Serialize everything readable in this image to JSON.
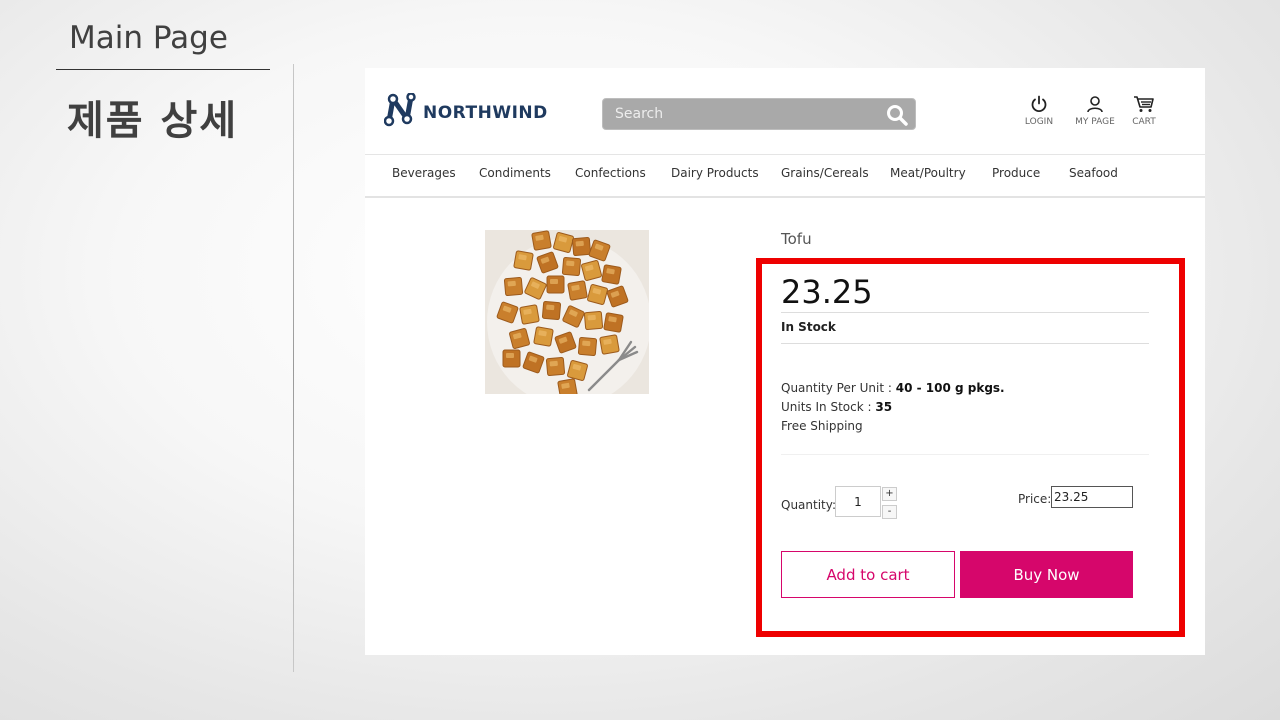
{
  "slide": {
    "title": "Main Page",
    "subtitle": "제품 상세"
  },
  "site": {
    "logo_text": "NORTHWIND",
    "search_placeholder": "Search",
    "header_icons": [
      {
        "label": "LOGIN",
        "icon": "power-icon"
      },
      {
        "label": "MY PAGE",
        "icon": "user-icon"
      },
      {
        "label": "CART",
        "icon": "cart-icon"
      }
    ],
    "categories": [
      "Beverages",
      "Condiments",
      "Confections",
      "Dairy Products",
      "Grains/Cereals",
      "Meat/Poultry",
      "Produce",
      "Seafood"
    ]
  },
  "product": {
    "name": "Tofu",
    "price": "23.25",
    "stock_status": "In Stock",
    "quantity_per_unit_label": "Quantity Per Unit : ",
    "quantity_per_unit": "40 - 100 g pkgs.",
    "units_in_stock_label": "Units In Stock : ",
    "units_in_stock": "35",
    "shipping": "Free Shipping",
    "quantity_label": "Quantity:",
    "quantity": "1",
    "increment": "+",
    "decrement": "-",
    "price_label": "Price:",
    "price_value": "23.25",
    "add_to_cart": "Add to cart",
    "buy_now": "Buy Now"
  },
  "colors": {
    "accent": "#d6066b",
    "highlight": "#ee0000",
    "logo": "#1f3a5f"
  }
}
